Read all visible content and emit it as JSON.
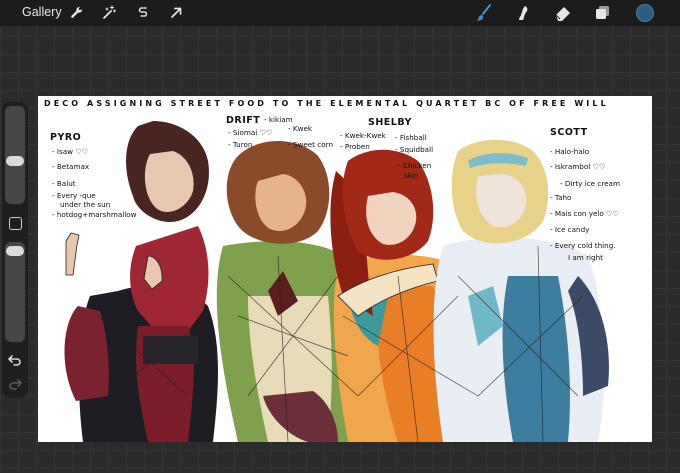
{
  "toolbar": {
    "gallery_label": "Gallery",
    "left_icons": [
      "wrench-icon",
      "magic-wand-icon",
      "selection-icon",
      "transform-arrow-icon"
    ],
    "right_icons": [
      "brush-icon",
      "smudge-icon",
      "eraser-icon",
      "layers-icon"
    ],
    "current_color": "#2a5f86"
  },
  "sidebar": {
    "brush_size_fraction": 0.75,
    "opacity_fraction": 0.95
  },
  "canvas": {
    "title": "DECO ASSIGNING STREET FOOD TO THE ELEMENTAL QUARTET BC OF FREE WILL",
    "characters": [
      {
        "name": "PYRO",
        "foods": [
          "- Isaw ♡♡",
          "- Betamax",
          "- Balut",
          "- Every -que",
          "under the sun",
          "- hotdog+marshmallow"
        ]
      },
      {
        "name": "DRIFT",
        "foods": [
          "- kikiam",
          "- Siomai ♡♡",
          "- Turon",
          "- Kwek",
          "- Sweet corn"
        ]
      },
      {
        "name": "SHELBY",
        "foods": [
          "- Kwek-Kwek",
          "- Proben",
          "- Fishball",
          "- Squidball",
          "- Chicken",
          "skin"
        ]
      },
      {
        "name": "SCOTT",
        "foods": [
          "- Halo-halo",
          "- Iskrambol ♡♡",
          "- Dirty ice cream",
          "- Taho",
          "- Mais con yelo ♡♡",
          "- Ice candy",
          "- Every cold thing.",
          "I am right"
        ]
      }
    ]
  }
}
